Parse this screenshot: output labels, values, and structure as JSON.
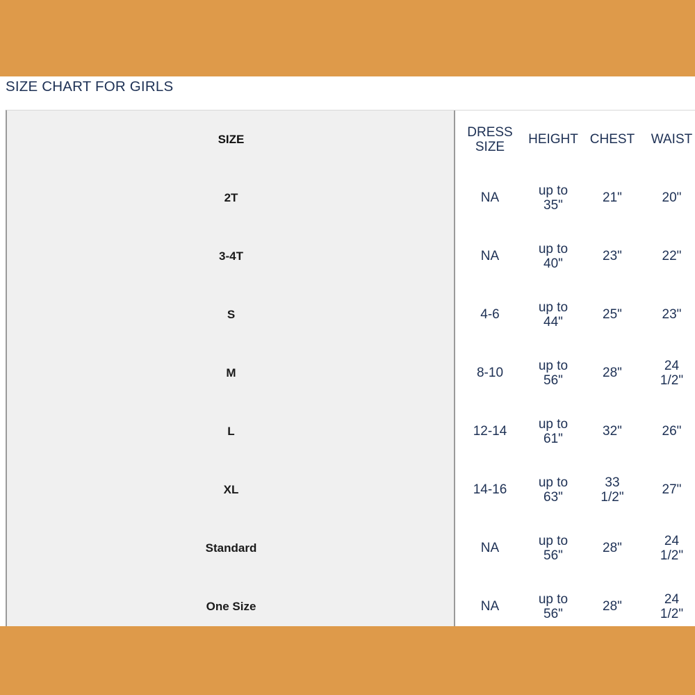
{
  "theme": {
    "band_color": "#de9a4a",
    "panel_gray": "#f0f0f0",
    "text_navy": "#1d3054",
    "divider": "#9a9a9a"
  },
  "page_title": "SIZE CHART FOR GIRLS",
  "chart_data": {
    "type": "table",
    "title": "SIZE CHART FOR GIRLS",
    "columns": [
      "SIZE",
      "DRESS SIZE",
      "HEIGHT",
      "CHEST",
      "WAIST"
    ],
    "headers": {
      "size": "SIZE",
      "dress_size_line1": "DRESS",
      "dress_size_line2": "SIZE",
      "height": "HEIGHT",
      "chest": "CHEST",
      "waist": "WAIST"
    },
    "rows": [
      {
        "size": "2T",
        "dress_size": "NA",
        "height_l1": "up to",
        "height_l2": "35\"",
        "chest_l1": "21\"",
        "chest_l2": "",
        "waist_l1": "20\"",
        "waist_l2": ""
      },
      {
        "size": "3-4T",
        "dress_size": "NA",
        "height_l1": "up to",
        "height_l2": "40\"",
        "chest_l1": "23\"",
        "chest_l2": "",
        "waist_l1": "22\"",
        "waist_l2": ""
      },
      {
        "size": "S",
        "dress_size": "4-6",
        "height_l1": "up to",
        "height_l2": "44\"",
        "chest_l1": "25\"",
        "chest_l2": "",
        "waist_l1": "23\"",
        "waist_l2": ""
      },
      {
        "size": "M",
        "dress_size": "8-10",
        "height_l1": "up to",
        "height_l2": "56\"",
        "chest_l1": "28\"",
        "chest_l2": "",
        "waist_l1": "24",
        "waist_l2": "1/2\""
      },
      {
        "size": "L",
        "dress_size": "12-14",
        "height_l1": "up to",
        "height_l2": "61\"",
        "chest_l1": "32\"",
        "chest_l2": "",
        "waist_l1": "26\"",
        "waist_l2": ""
      },
      {
        "size": "XL",
        "dress_size": "14-16",
        "height_l1": "up to",
        "height_l2": "63\"",
        "chest_l1": "33",
        "chest_l2": "1/2\"",
        "waist_l1": "27\"",
        "waist_l2": ""
      },
      {
        "size": "Standard",
        "dress_size": "NA",
        "height_l1": "up to",
        "height_l2": "56\"",
        "chest_l1": "28\"",
        "chest_l2": "",
        "waist_l1": "24",
        "waist_l2": "1/2\""
      },
      {
        "size": "One Size",
        "dress_size": "NA",
        "height_l1": "up to",
        "height_l2": "56\"",
        "chest_l1": "28\"",
        "chest_l2": "",
        "waist_l1": "24",
        "waist_l2": "1/2\""
      }
    ]
  }
}
